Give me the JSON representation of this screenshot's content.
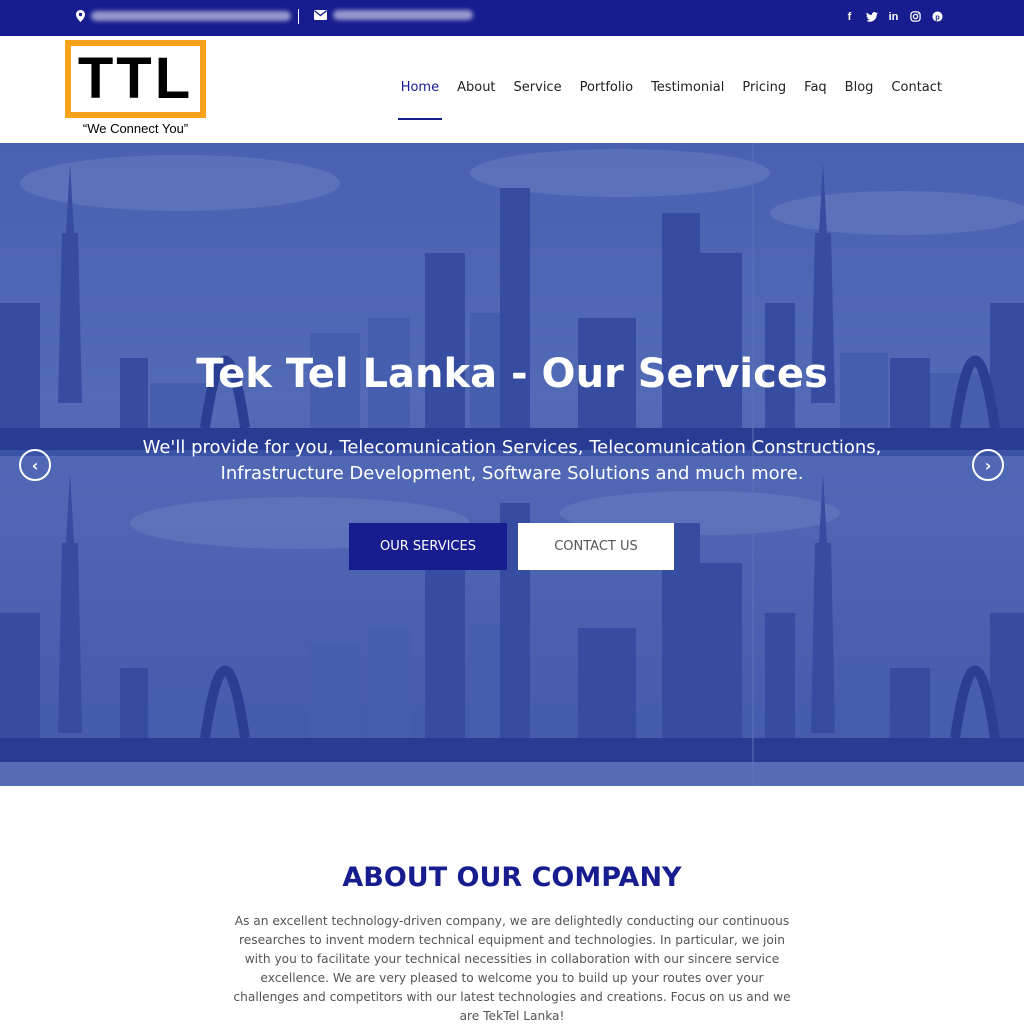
{
  "topbar": {
    "address_icon": "map-marker-icon",
    "email_icon": "envelope-icon",
    "socials": [
      {
        "name": "facebook-icon",
        "glyph": "f"
      },
      {
        "name": "twitter-icon",
        "glyph": "t"
      },
      {
        "name": "linkedin-icon",
        "glyph": "in"
      },
      {
        "name": "instagram-icon",
        "glyph": "◎"
      },
      {
        "name": "pinterest-icon",
        "glyph": "℗"
      }
    ]
  },
  "header": {
    "logo_text": "TTL",
    "logo_tagline": "“We Connect You”",
    "nav": [
      "Home",
      "About",
      "Service",
      "Portfolio",
      "Testimonial",
      "Pricing",
      "Faq",
      "Blog",
      "Contact"
    ],
    "active_nav": "Home"
  },
  "hero": {
    "title": "Tek Tel Lanka - Our Services",
    "subtitle": "We'll provide for you, Telecomunication Services, Telecomunication Constructions, Infrastructure Development, Software Solutions and much more.",
    "primary_button": "OUR SERVICES",
    "secondary_button": "CONTACT US",
    "prev_glyph": "‹",
    "next_glyph": "›"
  },
  "about": {
    "title": "ABOUT OUR COMPANY",
    "text": "As an excellent technology-driven company, we are delightedly conducting our continuous researches to invent modern technical equipment and technologies. In particular, we join with you to facilitate your technical necessities in collaboration with our sincere service excellence. We are very pleased to welcome you to build up your routes over your challenges and competitors with our latest technologies and creations. Focus on us and we are TekTel Lanka!"
  },
  "colors": {
    "brand_navy": "#171c8f",
    "logo_orange": "#f7a21b"
  }
}
